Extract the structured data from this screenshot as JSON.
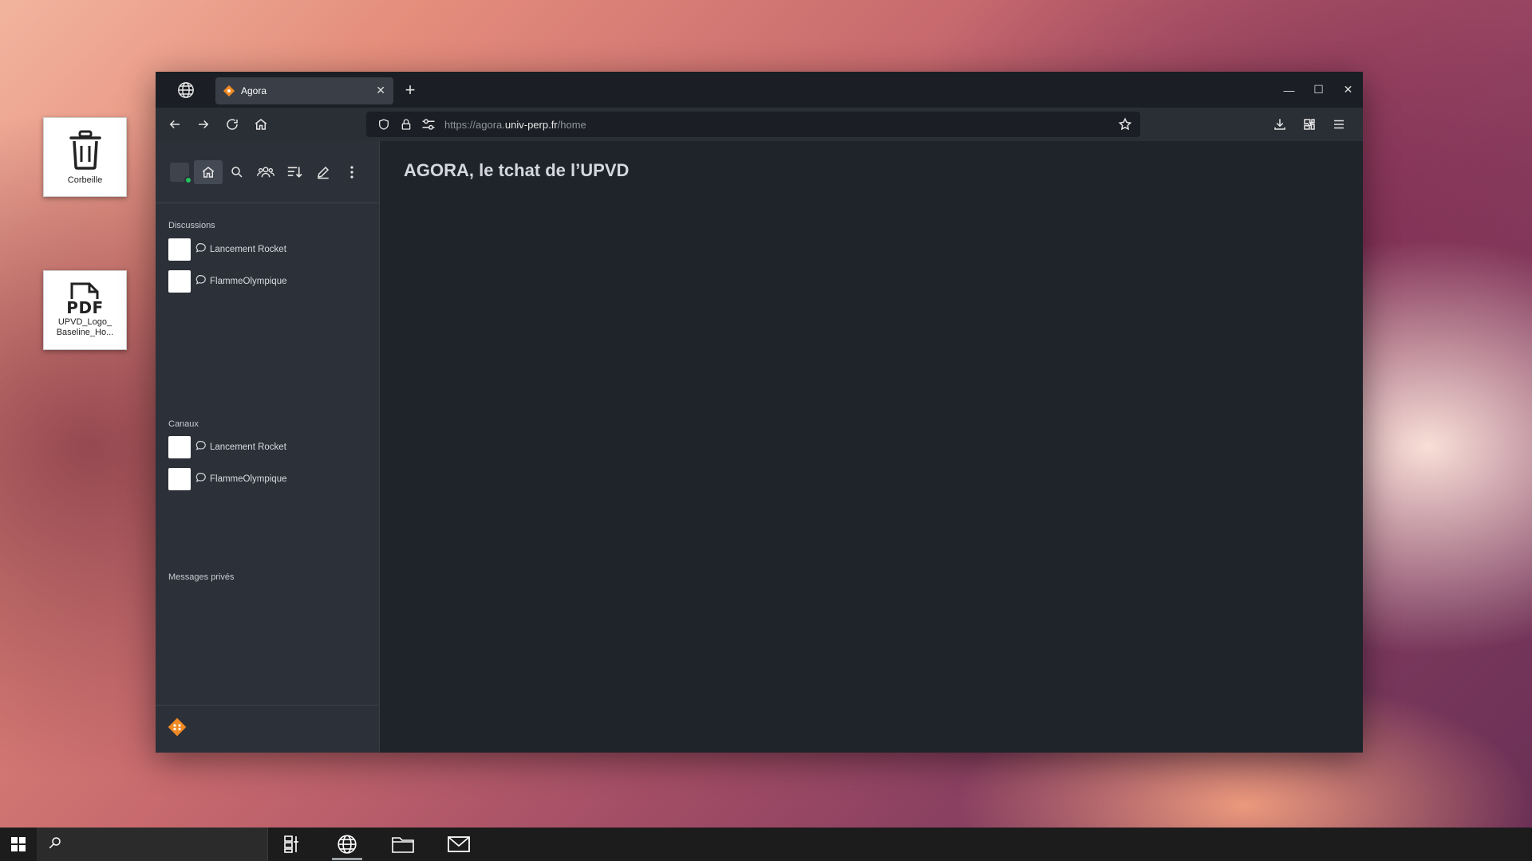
{
  "desktop": {
    "icons": [
      {
        "label": "Corbeille",
        "icon": "trash-icon"
      },
      {
        "label": "UPVD_Logo_\nBaseline_Ho...",
        "icon": "pdf-file-icon",
        "badge": "PDF"
      }
    ]
  },
  "browser": {
    "tab": {
      "title": "Agora",
      "favicon": "agora-favicon-icon"
    },
    "url": {
      "scheme_prefix": "https://agora.",
      "host": "univ-perp.fr",
      "path": "/home"
    }
  },
  "sidebar": {
    "sections": {
      "discussions": {
        "title": "Discussions",
        "rooms": [
          {
            "name": "Lancement Rocket"
          },
          {
            "name": "FlammeOlympique"
          }
        ]
      },
      "canaux": {
        "title": "Canaux",
        "rooms": [
          {
            "name": "Lancement Rocket"
          },
          {
            "name": "FlammeOlympique"
          }
        ]
      },
      "private": {
        "title": "Messages privés"
      }
    }
  },
  "main": {
    "title": "AGORA, le tchat de l’UPVD"
  },
  "colors": {
    "accent": "#f08a24",
    "online": "#22c55e"
  }
}
